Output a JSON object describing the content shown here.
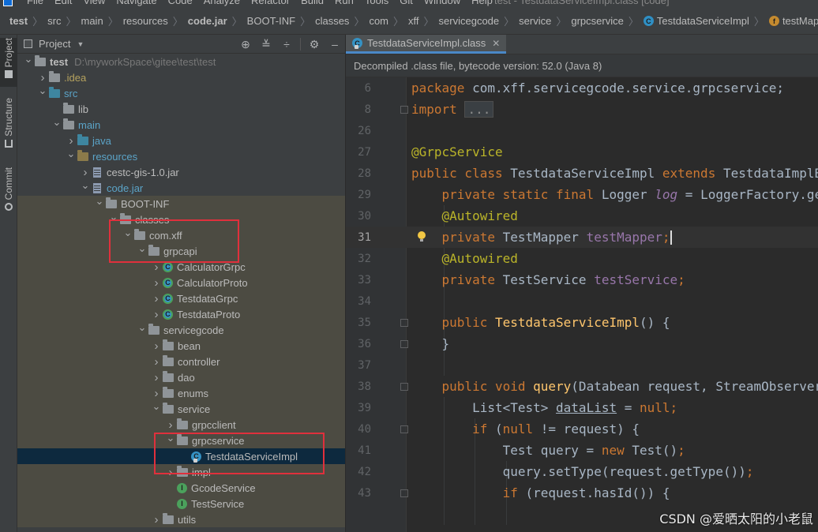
{
  "menu": {
    "items": [
      "File",
      "Edit",
      "View",
      "Navigate",
      "Code",
      "Analyze",
      "Refactor",
      "Build",
      "Run",
      "Tools",
      "Git",
      "Window",
      "Help"
    ],
    "window_title": "test - TestdataServiceImpl.class [code]"
  },
  "breadcrumb": [
    {
      "label": "test",
      "bold": true,
      "icon": ""
    },
    {
      "label": "src",
      "bold": false,
      "icon": ""
    },
    {
      "label": "main",
      "bold": false,
      "icon": ""
    },
    {
      "label": "resources",
      "bold": false,
      "icon": ""
    },
    {
      "label": "code.jar",
      "bold": true,
      "icon": ""
    },
    {
      "label": "BOOT-INF",
      "bold": false,
      "icon": ""
    },
    {
      "label": "classes",
      "bold": false,
      "icon": ""
    },
    {
      "label": "com",
      "bold": false,
      "icon": ""
    },
    {
      "label": "xff",
      "bold": false,
      "icon": ""
    },
    {
      "label": "servicegcode",
      "bold": false,
      "icon": ""
    },
    {
      "label": "service",
      "bold": false,
      "icon": ""
    },
    {
      "label": "grpcservice",
      "bold": false,
      "icon": ""
    },
    {
      "label": "TestdataServiceImpl",
      "bold": false,
      "icon": "class"
    },
    {
      "label": "testMapper",
      "bold": false,
      "icon": "field"
    }
  ],
  "toolstrip": {
    "tabs": [
      "Project",
      "Structure",
      "Commit"
    ]
  },
  "project": {
    "title": "Project",
    "tree": [
      {
        "depth": 0,
        "arrow": "down",
        "icon": "folder",
        "label": "test",
        "style": "bold",
        "sub": "D:\\myworkSpace\\gitee\\test\\test",
        "band": false,
        "selected": false
      },
      {
        "depth": 1,
        "arrow": "right",
        "icon": "folder",
        "label": ".idea",
        "style": "gold",
        "sub": "",
        "band": false,
        "selected": false
      },
      {
        "depth": 1,
        "arrow": "down",
        "icon": "folder-blue",
        "label": "src",
        "style": "blue",
        "sub": "",
        "band": false,
        "selected": false
      },
      {
        "depth": 2,
        "arrow": "none",
        "icon": "folder",
        "label": "lib",
        "style": "",
        "sub": "",
        "band": false,
        "selected": false
      },
      {
        "depth": 2,
        "arrow": "down",
        "icon": "folder",
        "label": "main",
        "style": "blue",
        "sub": "",
        "band": false,
        "selected": false
      },
      {
        "depth": 3,
        "arrow": "right",
        "icon": "folder-blue",
        "label": "java",
        "style": "blue",
        "sub": "",
        "band": false,
        "selected": false
      },
      {
        "depth": 3,
        "arrow": "down",
        "icon": "folder-orange",
        "label": "resources",
        "style": "blue",
        "sub": "",
        "band": false,
        "selected": false
      },
      {
        "depth": 4,
        "arrow": "right",
        "icon": "jar",
        "label": "cestc-gis-1.0.jar",
        "style": "",
        "sub": "",
        "band": false,
        "selected": false
      },
      {
        "depth": 4,
        "arrow": "down",
        "icon": "jar",
        "label": "code.jar",
        "style": "blue",
        "sub": "",
        "band": false,
        "selected": false
      },
      {
        "depth": 5,
        "arrow": "down",
        "icon": "folder",
        "label": "BOOT-INF",
        "style": "",
        "sub": "",
        "band": true,
        "selected": false
      },
      {
        "depth": 6,
        "arrow": "down",
        "icon": "folder",
        "label": "classes",
        "style": "",
        "sub": "",
        "band": true,
        "selected": false
      },
      {
        "depth": 7,
        "arrow": "down",
        "icon": "folder",
        "label": "com.xff",
        "style": "",
        "sub": "",
        "band": true,
        "selected": false
      },
      {
        "depth": 8,
        "arrow": "down",
        "icon": "folder",
        "label": "grpcapi",
        "style": "",
        "sub": "",
        "band": true,
        "selected": false
      },
      {
        "depth": 9,
        "arrow": "right",
        "icon": "class-grp",
        "label": "CalculatorGrpc",
        "style": "",
        "sub": "",
        "band": true,
        "selected": false
      },
      {
        "depth": 9,
        "arrow": "right",
        "icon": "class-grp",
        "label": "CalculatorProto",
        "style": "",
        "sub": "",
        "band": true,
        "selected": false
      },
      {
        "depth": 9,
        "arrow": "right",
        "icon": "class-grp",
        "label": "TestdataGrpc",
        "style": "",
        "sub": "",
        "band": true,
        "selected": false
      },
      {
        "depth": 9,
        "arrow": "right",
        "icon": "class-grp",
        "label": "TestdataProto",
        "style": "",
        "sub": "",
        "band": true,
        "selected": false
      },
      {
        "depth": 8,
        "arrow": "down",
        "icon": "folder",
        "label": "servicegcode",
        "style": "",
        "sub": "",
        "band": true,
        "selected": false
      },
      {
        "depth": 9,
        "arrow": "right",
        "icon": "folder",
        "label": "bean",
        "style": "",
        "sub": "",
        "band": true,
        "selected": false
      },
      {
        "depth": 9,
        "arrow": "right",
        "icon": "folder",
        "label": "controller",
        "style": "",
        "sub": "",
        "band": true,
        "selected": false
      },
      {
        "depth": 9,
        "arrow": "right",
        "icon": "folder",
        "label": "dao",
        "style": "",
        "sub": "",
        "band": true,
        "selected": false
      },
      {
        "depth": 9,
        "arrow": "right",
        "icon": "folder",
        "label": "enums",
        "style": "",
        "sub": "",
        "band": true,
        "selected": false
      },
      {
        "depth": 9,
        "arrow": "down",
        "icon": "folder",
        "label": "service",
        "style": "",
        "sub": "",
        "band": true,
        "selected": false
      },
      {
        "depth": 10,
        "arrow": "right",
        "icon": "folder",
        "label": "grpcclient",
        "style": "",
        "sub": "",
        "band": true,
        "selected": false
      },
      {
        "depth": 10,
        "arrow": "down",
        "icon": "folder",
        "label": "grpcservice",
        "style": "",
        "sub": "",
        "band": true,
        "selected": false
      },
      {
        "depth": 11,
        "arrow": "none",
        "icon": "class-lock",
        "label": "TestdataServiceImpl",
        "style": "",
        "sub": "",
        "band": false,
        "selected": true
      },
      {
        "depth": 10,
        "arrow": "right",
        "icon": "folder",
        "label": "impl",
        "style": "",
        "sub": "",
        "band": true,
        "selected": false
      },
      {
        "depth": 10,
        "arrow": "none",
        "icon": "interface",
        "label": "GcodeService",
        "style": "",
        "sub": "",
        "band": true,
        "selected": false
      },
      {
        "depth": 10,
        "arrow": "none",
        "icon": "interface",
        "label": "TestService",
        "style": "",
        "sub": "",
        "band": true,
        "selected": false
      },
      {
        "depth": 9,
        "arrow": "right",
        "icon": "folder",
        "label": "utils",
        "style": "",
        "sub": "",
        "band": true,
        "selected": false
      }
    ]
  },
  "editor": {
    "tab_label": "TestdataServiceImpl.class",
    "banner": "Decompiled .class file, bytecode version: 52.0 (Java 8)",
    "current_line": "31",
    "lines": [
      {
        "num": "6",
        "fold": false,
        "bulb": false,
        "tokens": [
          [
            "kw",
            "package "
          ],
          [
            "",
            "com.xff.servicegcode.service.grpcservice;"
          ]
        ]
      },
      {
        "num": "8",
        "fold": true,
        "bulb": false,
        "tokens": [
          [
            "kw",
            "import "
          ],
          [
            "foldtext",
            "..."
          ]
        ]
      },
      {
        "num": "26",
        "fold": false,
        "bulb": false,
        "tokens": []
      },
      {
        "num": "27",
        "fold": false,
        "bulb": false,
        "tokens": [
          [
            "ann",
            "@GrpcService"
          ]
        ]
      },
      {
        "num": "28",
        "fold": false,
        "bulb": false,
        "tokens": [
          [
            "kw",
            "public class "
          ],
          [
            "",
            "TestdataServiceImpl "
          ],
          [
            "kw",
            "extends "
          ],
          [
            "",
            "TestdataImplBase"
          ]
        ]
      },
      {
        "num": "29",
        "fold": false,
        "bulb": false,
        "tokens": [
          [
            "",
            "    "
          ],
          [
            "kw",
            "private static final "
          ],
          [
            "",
            "Logger "
          ],
          [
            "fldi",
            "log"
          ],
          [
            "",
            " = LoggerFactory.getLogger"
          ]
        ]
      },
      {
        "num": "30",
        "fold": false,
        "bulb": false,
        "tokens": [
          [
            "",
            "    "
          ],
          [
            "ann",
            "@Autowired"
          ]
        ]
      },
      {
        "num": "31",
        "fold": false,
        "bulb": true,
        "tokens": [
          [
            "",
            "    "
          ],
          [
            "kw",
            "private "
          ],
          [
            "",
            "TestMapper "
          ],
          [
            "fld",
            "testMapper"
          ],
          [
            "kw",
            ";"
          ],
          [
            "caret",
            ""
          ]
        ]
      },
      {
        "num": "32",
        "fold": false,
        "bulb": false,
        "tokens": [
          [
            "",
            "    "
          ],
          [
            "ann",
            "@Autowired"
          ]
        ]
      },
      {
        "num": "33",
        "fold": false,
        "bulb": false,
        "tokens": [
          [
            "",
            "    "
          ],
          [
            "kw",
            "private "
          ],
          [
            "",
            "TestService "
          ],
          [
            "fld",
            "testService"
          ],
          [
            "kw",
            ";"
          ]
        ]
      },
      {
        "num": "34",
        "fold": false,
        "bulb": false,
        "tokens": []
      },
      {
        "num": "35",
        "fold": true,
        "bulb": false,
        "tokens": [
          [
            "",
            "    "
          ],
          [
            "kw",
            "public "
          ],
          [
            "mth",
            "TestdataServiceImpl"
          ],
          [
            "",
            "() {"
          ]
        ]
      },
      {
        "num": "36",
        "fold": true,
        "bulb": false,
        "tokens": [
          [
            "",
            "    }"
          ]
        ]
      },
      {
        "num": "37",
        "fold": false,
        "bulb": false,
        "tokens": []
      },
      {
        "num": "38",
        "fold": true,
        "bulb": false,
        "tokens": [
          [
            "",
            "    "
          ],
          [
            "kw",
            "public void "
          ],
          [
            "mth",
            "query"
          ],
          [
            "",
            "(Databean request, StreamObserver"
          ]
        ]
      },
      {
        "num": "39",
        "fold": false,
        "bulb": false,
        "tokens": [
          [
            "",
            "        List<Test> "
          ],
          [
            "und",
            "dataList"
          ],
          [
            "",
            " = "
          ],
          [
            "kw",
            "null"
          ],
          [
            "kw",
            ";"
          ]
        ]
      },
      {
        "num": "40",
        "fold": true,
        "bulb": false,
        "tokens": [
          [
            "",
            "        "
          ],
          [
            "kw",
            "if "
          ],
          [
            "",
            "("
          ],
          [
            "kw",
            "null "
          ],
          [
            "",
            "!= request) {"
          ]
        ]
      },
      {
        "num": "41",
        "fold": false,
        "bulb": false,
        "tokens": [
          [
            "",
            "            Test query = "
          ],
          [
            "kw",
            "new "
          ],
          [
            "",
            "Test()"
          ],
          [
            "kw",
            ";"
          ]
        ]
      },
      {
        "num": "42",
        "fold": false,
        "bulb": false,
        "tokens": [
          [
            "",
            "            query.setType(request.getType())"
          ],
          [
            "kw",
            ";"
          ]
        ]
      },
      {
        "num": "43",
        "fold": true,
        "bulb": false,
        "tokens": [
          [
            "",
            "            "
          ],
          [
            "kw",
            "if "
          ],
          [
            "",
            "(request.hasId()) {"
          ]
        ]
      }
    ]
  },
  "watermark": "CSDN @爱晒太阳的小老鼠",
  "colors": {
    "keyword": "#cc7832",
    "annotation": "#bbb529",
    "field": "#9876aa",
    "method": "#ffc66d",
    "highlight_box": "#e0303c",
    "selection": "#0d293e"
  }
}
